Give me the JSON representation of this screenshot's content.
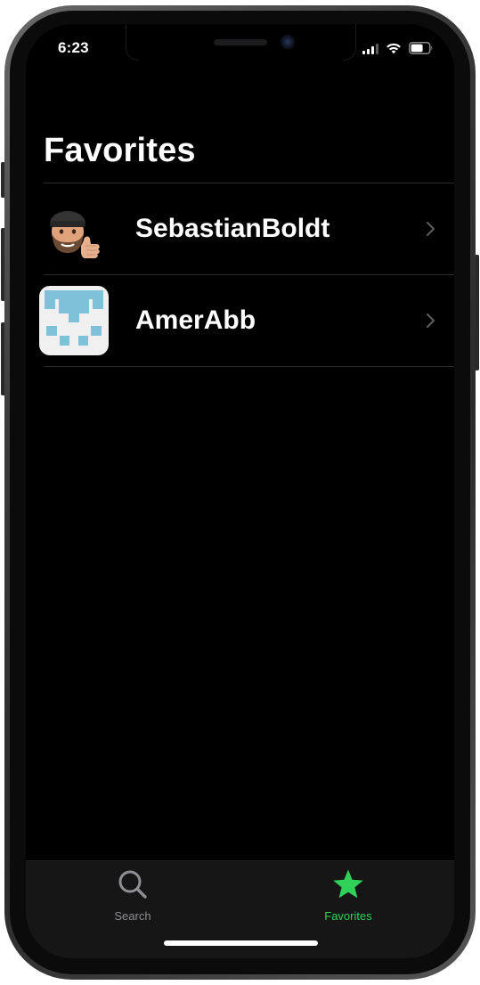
{
  "status_bar": {
    "time": "6:23",
    "icons": [
      "cellular-signal-icon",
      "wifi-icon",
      "battery-icon"
    ]
  },
  "page": {
    "title": "Favorites"
  },
  "favorites": [
    {
      "name": "SebastianBoldt",
      "avatar": "memoji-thumbs-up-avatar",
      "chevron": "chevron-right-icon"
    },
    {
      "name": "AmerAbb",
      "avatar": "identicon-avatar",
      "chevron": "chevron-right-icon"
    }
  ],
  "tab_bar": {
    "tabs": [
      {
        "label": "Search",
        "icon": "search-icon",
        "selected": false
      },
      {
        "label": "Favorites",
        "icon": "star-icon",
        "selected": true
      }
    ]
  },
  "colors": {
    "background": "#000000",
    "text": "#ffffff",
    "separator": "#2c2c2e",
    "chevron": "#5a5a5e",
    "tab_inactive": "#8e8e93",
    "tab_active": "#30d158",
    "tabbar_bg": "#161616",
    "identicon_blue": "#7ec1d9",
    "identicon_bg": "#f0f0f0"
  }
}
